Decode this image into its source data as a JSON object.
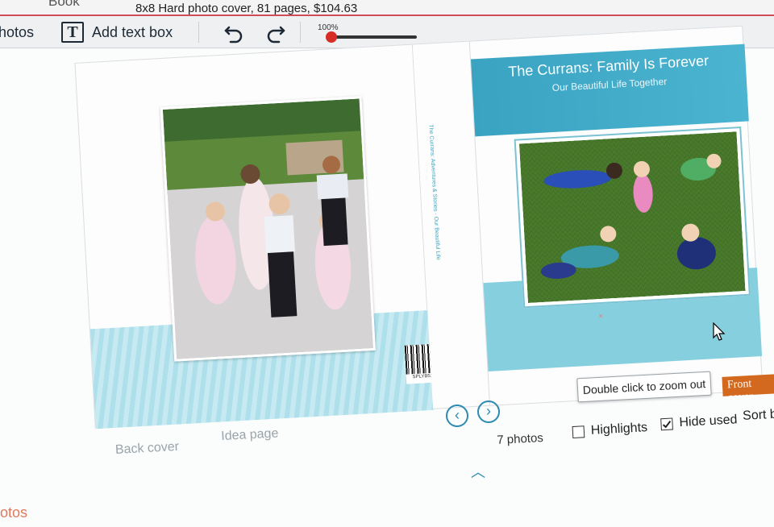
{
  "topbar": {
    "book_tab": "Book",
    "product_title": "8x8 Hard photo cover, 81 pages, $104.63"
  },
  "toolbar": {
    "photos_tab": "hotos",
    "add_text_box_label": "Add text box",
    "add_text_box_icon": "text-box-icon",
    "undo_icon": "undo-icon",
    "redo_icon": "redo-icon",
    "zoom_label": "100%",
    "zoom_fraction": 0.05
  },
  "spread": {
    "back_cover_label": "Back cover",
    "idea_page_label": "Idea page",
    "barcode_text": "SPLYB51114-347",
    "spine_text": "The Currans: Adventures & Stories · Our Beautiful Life",
    "front_title": "The Currans: Family Is Forever",
    "front_subtitle": "Our Beautiful Life Together",
    "accent_color": "#3aa3c2"
  },
  "tooltip": "Double click to zoom out",
  "front_cover_tag": "Front cover",
  "nav": {
    "prev_icon": "chevron-left-icon",
    "next_icon": "chevron-right-icon"
  },
  "filters": {
    "photo_count": "7 photos",
    "highlights_label": "Highlights",
    "highlights_checked": false,
    "hide_used_label": "Hide used",
    "hide_used_checked": true,
    "sort_by_label": "Sort by"
  },
  "bottom": {
    "photos_tab": "otos"
  }
}
